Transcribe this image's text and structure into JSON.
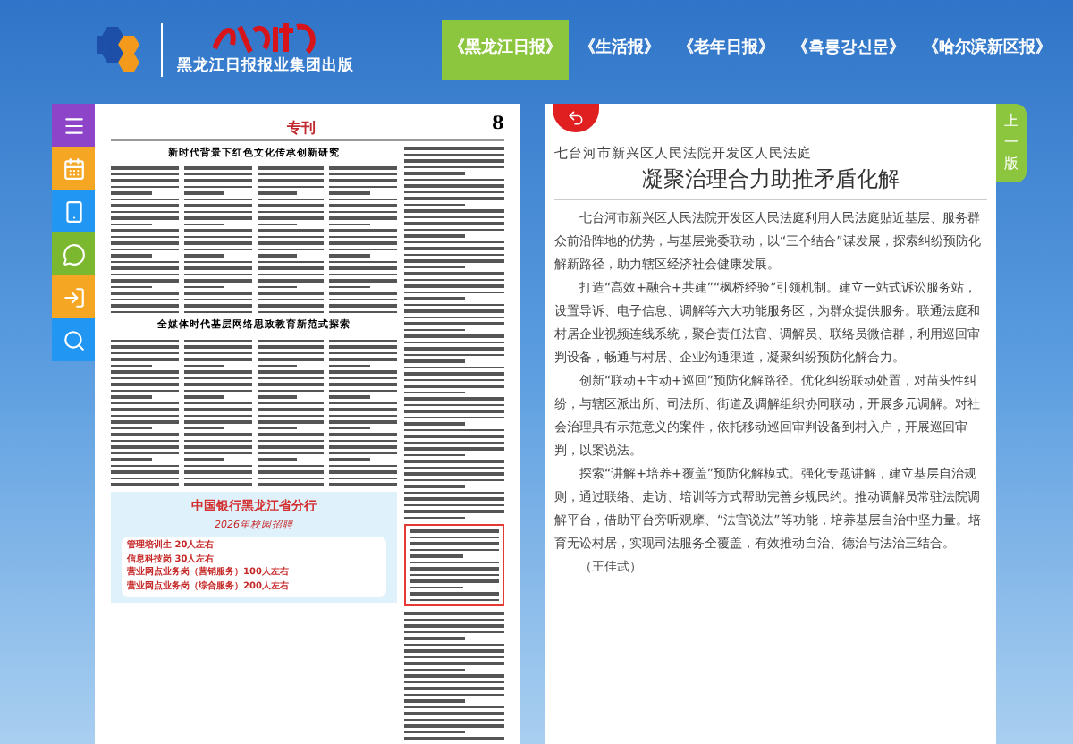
{
  "header": {
    "publisher": "黑龙江日报报业集团出版",
    "tabs": [
      {
        "label": "《黑龙江日报》",
        "selected": true
      },
      {
        "label": "《生活报》",
        "selected": false
      },
      {
        "label": "《老年日报》",
        "selected": false
      },
      {
        "label": "《흑룡강신문》",
        "selected": false
      },
      {
        "label": "《哈尔滨新区报》",
        "selected": false
      }
    ]
  },
  "sidebar": {
    "items": [
      {
        "kind": "menu",
        "color": "#8e44c8"
      },
      {
        "kind": "calendar",
        "color": "#f5a623"
      },
      {
        "kind": "phone",
        "color": "#2196f3"
      },
      {
        "kind": "wechat",
        "color": "#7cb82f"
      },
      {
        "kind": "export",
        "color": "#f5a623"
      },
      {
        "kind": "search",
        "color": "#2196f3"
      }
    ]
  },
  "newspaper": {
    "section": "专刊",
    "page": "8",
    "headlines": [
      "新时代背景下红色文化传承创新研究",
      "全媒体时代基层网络思政教育新范式探索"
    ],
    "ad": {
      "title": "中国银行黑龙江省分行",
      "subtitle": "2026年校园招聘",
      "lines": [
        "管理培训生 20人左右",
        "信息科技岗 30人左右",
        "营业网点业务岗（营销服务）100人左右",
        "营业网点业务岗（综合服务）200人左右"
      ]
    }
  },
  "article": {
    "kicker": "七台河市新兴区人民法院开发区人民法庭",
    "title": "凝聚治理合力助推矛盾化解",
    "paragraphs": [
      "七台河市新兴区人民法院开发区人民法庭利用人民法庭贴近基层、服务群众前沿阵地的优势，与基层党委联动，以“三个结合”谋发展，探索纠纷预防化解新路径，助力辖区经济社会健康发展。",
      "打造“高效+融合+共建”“枫桥经验”引领机制。建立一站式诉讼服务站，设置导诉、电子信息、调解等六大功能服务区，为群众提供服务。联通法庭和村居企业视频连线系统，聚合责任法官、调解员、联络员微信群，利用巡回审判设备，畅通与村居、企业沟通渠道，凝聚纠纷预防化解合力。",
      "创新“联动+主动+巡回”预防化解路径。优化纠纷联动处置，对苗头性纠纷，与辖区派出所、司法所、街道及调解组织协同联动，开展多元调解。对社会治理具有示范意义的案件，依托移动巡回审判设备到村入户，开展巡回审判，以案说法。",
      "探索“讲解+培养+覆盖”预防化解模式。强化专题讲解，建立基层自治规则，通过联络、走访、培训等方式帮助完善乡规民约。推动调解员常驻法院调解平台，借助平台旁听观摩、“法官说法”等功能，培养基层自治中坚力量。培育无讼村居，实现司法服务全覆盖，有效推动自治、德治与法治三结合。"
    ],
    "author": "（王佳武）",
    "prev_page": "上一版"
  }
}
